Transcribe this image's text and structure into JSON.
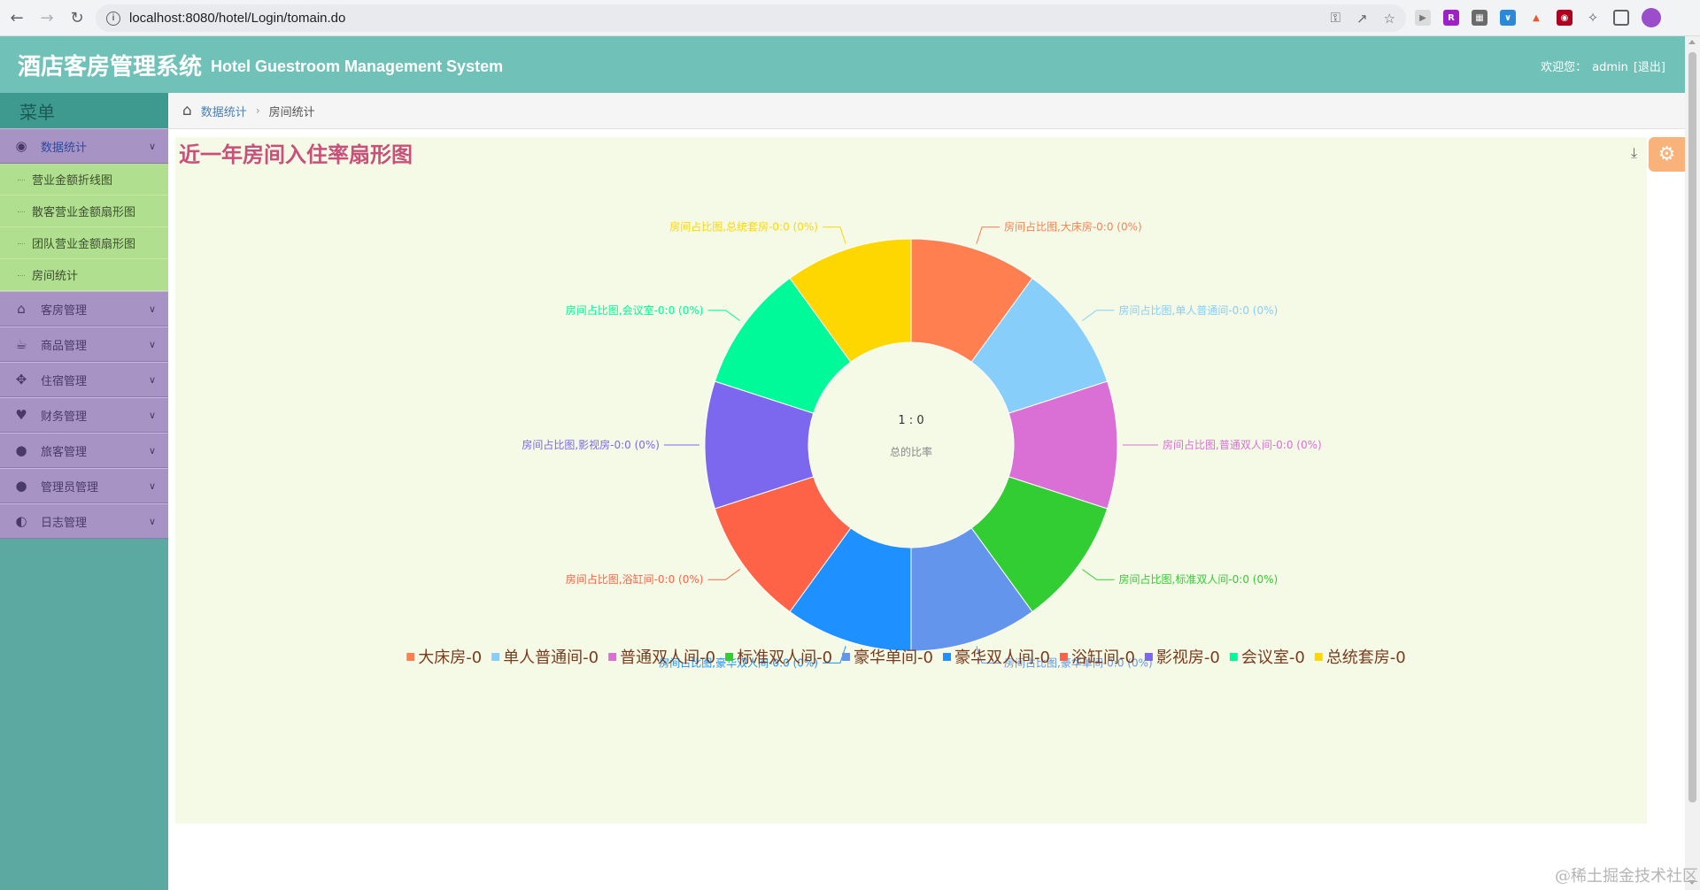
{
  "browser": {
    "url": "localhost:8080/hotel/Login/tomain.do"
  },
  "header": {
    "title_cn": "酒店客房管理系统",
    "title_en": "Hotel Guestroom Management System",
    "welcome": "欢迎您：",
    "user": "admin",
    "logout": "[退出]"
  },
  "sidebar": {
    "title": "菜单",
    "groups": [
      {
        "label": "数据统计",
        "icon": "dashboard-icon",
        "expanded": true,
        "items": [
          {
            "label": "营业金额折线图"
          },
          {
            "label": "散客营业金额扇形图"
          },
          {
            "label": "团队营业金额扇形图"
          },
          {
            "label": "房间统计"
          }
        ]
      },
      {
        "label": "客房管理",
        "icon": "home-icon"
      },
      {
        "label": "商品管理",
        "icon": "cup-icon"
      },
      {
        "label": "住宿管理",
        "icon": "move-icon"
      },
      {
        "label": "财务管理",
        "icon": "heart-icon"
      },
      {
        "label": "旅客管理",
        "icon": "user-icon"
      },
      {
        "label": "管理员管理",
        "icon": "user-icon"
      },
      {
        "label": "日志管理",
        "icon": "adjust-icon"
      }
    ]
  },
  "breadcrumb": {
    "link": "数据统计",
    "current": "房间统计"
  },
  "panel": {
    "title": "近一年房间入住率扇形图"
  },
  "chart_data": {
    "type": "pie",
    "center_value": "1 : 0",
    "center_label": "总的比率",
    "label_prefix": "房间占比图,",
    "slices": [
      {
        "name": "大床房",
        "value": 0,
        "label": "房间占比图,大床房-0:0 (0%)",
        "legend": "大床房-0",
        "color": "#ff7f50"
      },
      {
        "name": "单人普通间",
        "value": 0,
        "label": "房间占比图,单人普通间-0:0 (0%)",
        "legend": "单人普通间-0",
        "color": "#87cefa"
      },
      {
        "name": "普通双人间",
        "value": 0,
        "label": "房间占比图,普通双人间-0:0 (0%)",
        "legend": "普通双人间-0",
        "color": "#da70d6"
      },
      {
        "name": "标准双人间",
        "value": 0,
        "label": "房间占比图,标准双人间-0:0 (0%)",
        "legend": "标准双人间-0",
        "color": "#32cd32"
      },
      {
        "name": "豪华单间",
        "value": 0,
        "label": "房间占比图,豪华单间-0:0 (0%)",
        "legend": "豪华单间-0",
        "color": "#6495ed"
      },
      {
        "name": "豪华双人间",
        "value": 0,
        "label": "房间占比图,豪华双人间-0:0 (0%)",
        "legend": "豪华双人间-0",
        "color": "#1e90ff"
      },
      {
        "name": "浴缸间",
        "value": 0,
        "label": "房间占比图,浴缸间-0:0 (0%)",
        "legend": "浴缸间-0",
        "color": "#ff6347"
      },
      {
        "name": "影视房",
        "value": 0,
        "label": "房间占比图,影视房-0:0 (0%)",
        "legend": "影视房-0",
        "color": "#7b68ee"
      },
      {
        "name": "会议室",
        "value": 0,
        "label": "房间占比图,会议室-0:0 (0%)",
        "legend": "会议室-0",
        "color": "#00fa9a"
      },
      {
        "name": "总统套房",
        "value": 0,
        "label": "房间占比图,总统套房-0:0 (0%)",
        "legend": "总统套房-0",
        "color": "#ffd700"
      }
    ],
    "legend_position": "bottom"
  },
  "watermark": "@稀土掘金技术社区"
}
